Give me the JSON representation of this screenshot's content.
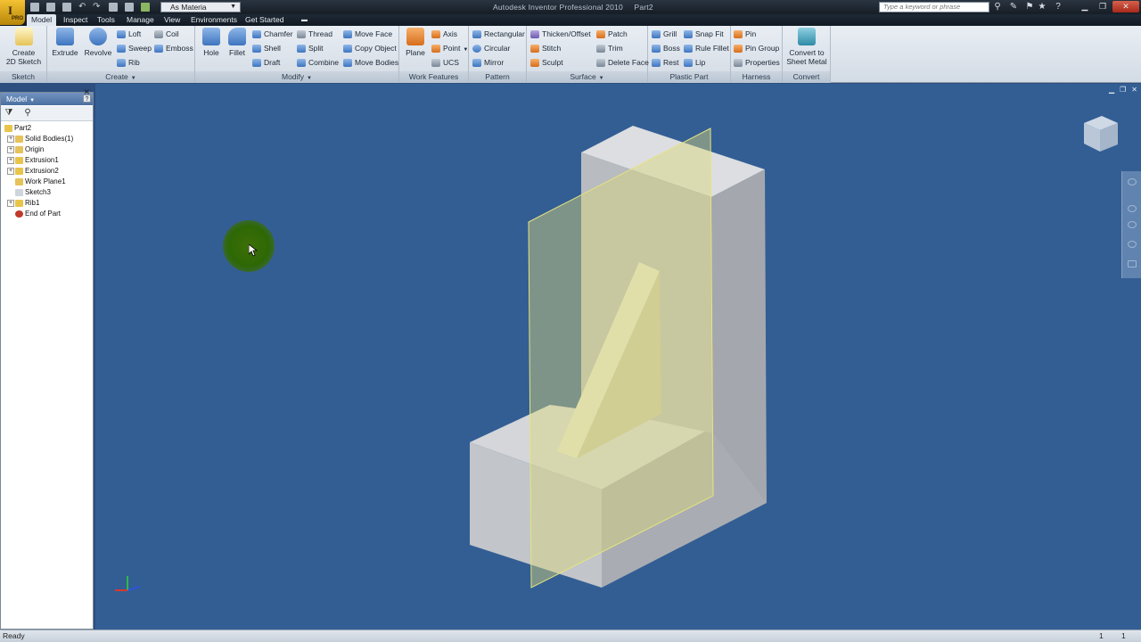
{
  "app": {
    "badge": "I",
    "badge_sub": "PRO",
    "title": "Autodesk Inventor Professional 2010",
    "document": "Part2",
    "material": "As Materia",
    "search_placeholder": "Type a keyword or phrase"
  },
  "menu_tabs": [
    "Model",
    "Inspect",
    "Tools",
    "Manage",
    "View",
    "Environments",
    "Get Started"
  ],
  "active_tab": "Model",
  "ribbon": {
    "sketch": {
      "title": "Sketch",
      "create": "Create",
      "create2": "2D Sketch"
    },
    "create": {
      "title": "Create",
      "extrude": "Extrude",
      "revolve": "Revolve",
      "loft": "Loft",
      "sweep": "Sweep",
      "rib": "Rib",
      "coil": "Coil",
      "emboss": "Emboss"
    },
    "modify": {
      "title": "Modify",
      "hole": "Hole",
      "fillet": "Fillet",
      "chamfer": "Chamfer",
      "shell": "Shell",
      "draft": "Draft",
      "thread": "Thread",
      "split": "Split",
      "combine": "Combine",
      "move_face": "Move Face",
      "copy_object": "Copy Object",
      "move_bodies": "Move Bodies"
    },
    "work_features": {
      "title": "Work Features",
      "plane": "Plane",
      "axis": "Axis",
      "point": "Point",
      "ucs": "UCS"
    },
    "pattern": {
      "title": "Pattern",
      "rectangular": "Rectangular",
      "circular": "Circular",
      "mirror": "Mirror"
    },
    "surface": {
      "title": "Surface",
      "thicken": "Thicken/Offset",
      "stitch": "Stitch",
      "sculpt": "Sculpt",
      "patch": "Patch",
      "trim": "Trim",
      "delete_face": "Delete Face"
    },
    "plastic_part": {
      "title": "Plastic Part",
      "grill": "Grill",
      "boss": "Boss",
      "rest": "Rest",
      "snap_fit": "Snap Fit",
      "rule_fillet": "Rule Fillet",
      "lip": "Lip"
    },
    "harness": {
      "title": "Harness",
      "pin": "Pin",
      "pin_group": "Pin Group",
      "properties": "Properties"
    },
    "convert": {
      "title": "Convert",
      "label1": "Convert to",
      "label2": "Sheet Metal"
    }
  },
  "browser": {
    "title": "Model",
    "tree": [
      {
        "label": "Part2",
        "icon": "part-icon",
        "expand": false,
        "indent": 0
      },
      {
        "label": "Solid Bodies(1)",
        "icon": "folder-icon",
        "expand": true,
        "indent": 1
      },
      {
        "label": "Origin",
        "icon": "folder-icon",
        "expand": true,
        "indent": 1
      },
      {
        "label": "Extrusion1",
        "icon": "extrude-icon",
        "expand": true,
        "indent": 1
      },
      {
        "label": "Extrusion2",
        "icon": "extrude-icon",
        "expand": true,
        "indent": 1
      },
      {
        "label": "Work Plane1",
        "icon": "work-plane-icon",
        "expand": false,
        "indent": 1
      },
      {
        "label": "Sketch3",
        "icon": "sketch-icon",
        "expand": false,
        "indent": 1
      },
      {
        "label": "Rib1",
        "icon": "rib-icon",
        "expand": true,
        "indent": 1
      },
      {
        "label": "End of Part",
        "icon": "end-of-part-icon",
        "expand": false,
        "indent": 1
      }
    ]
  },
  "colors": {
    "viewport_bg": "#335e94",
    "solid_light": "#d6d8dc",
    "solid_mid": "#a9adb3",
    "work_plane": "#d9d77a"
  },
  "status": {
    "text": "Ready",
    "n1": "1",
    "n2": "1"
  }
}
